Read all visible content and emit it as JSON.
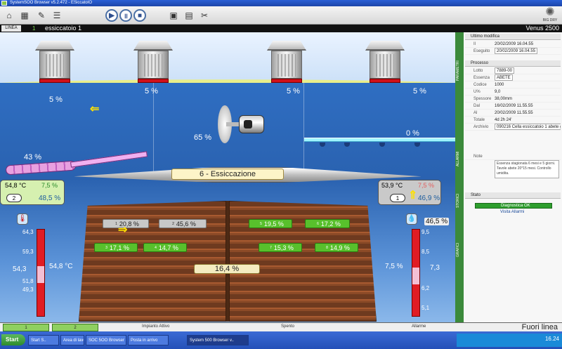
{
  "window": {
    "title": "SystemSOO Browser v5.2.472 - ESiccatoIO"
  },
  "toolbar": {
    "buttons": [
      {
        "name": "home-icon",
        "glyph": "⌂"
      },
      {
        "name": "chart-icon",
        "glyph": "▦"
      },
      {
        "name": "report-icon",
        "glyph": "✎"
      },
      {
        "name": "list-icon",
        "glyph": "☰"
      },
      {
        "name": "play-icon",
        "glyph": "▶"
      },
      {
        "name": "pause-icon",
        "glyph": "॥"
      },
      {
        "name": "stop-icon",
        "glyph": "■"
      },
      {
        "name": "screen-icon",
        "glyph": "▣"
      },
      {
        "name": "doc-icon",
        "glyph": "▤"
      },
      {
        "name": "tools-icon",
        "glyph": "✂"
      }
    ],
    "logo_text": "BIG DRY"
  },
  "header": {
    "tab_label": "LINEA",
    "number": "1",
    "kiln_name": "essiccatoio 1",
    "model": "Venus 2500"
  },
  "scene": {
    "vents_pct": [
      "5 %",
      "5 %",
      "5 %"
    ],
    "left_inlet_pct": "5 %",
    "fan_pct": "65 %",
    "humidifier_pct": "0 %",
    "heater_pct": "43 %",
    "phase": "6 - Essiccazione",
    "panel_left": {
      "temp": "54,8 °C",
      "humidity": "7,5 %",
      "index": "2",
      "rh": "48,5 %"
    },
    "panel_right": {
      "temp": "53,9 °C",
      "humidity": "7,5 %",
      "index": "1",
      "rh": "46,9 %"
    },
    "moisture_probes_top": [
      {
        "n": "1",
        "value": "20,8 %",
        "state": "gray"
      },
      {
        "n": "2",
        "value": "45,6 %",
        "state": "gray"
      },
      {
        "n": "5",
        "value": "19,5 %",
        "state": "green"
      },
      {
        "n": "6",
        "value": "17,2 %",
        "state": "green"
      }
    ],
    "moisture_probes_bottom": [
      {
        "n": "3",
        "value": "17,1 %",
        "state": "green"
      },
      {
        "n": "4",
        "value": "14,7 %",
        "state": "green"
      },
      {
        "n": "7",
        "value": "15,3 %",
        "state": "green"
      },
      {
        "n": "8",
        "value": "14,9 %",
        "state": "green"
      }
    ],
    "average_moisture": "16,4 %",
    "gauge_left": {
      "ticks": [
        "64,3",
        "59,3",
        "51,8",
        "49,3"
      ],
      "value": "54,3",
      "setpoint": "54,8 °C"
    },
    "gauge_right": {
      "ticks": [
        "9,5",
        "8,5",
        "6,2",
        "5,1"
      ],
      "value": "7,3",
      "setpoint": "7,5 %",
      "top_value": "46,5 %"
    }
  },
  "bottombar": {
    "tabs": [
      "1",
      "2"
    ],
    "status_a": "Impianto Attivo",
    "status_b": "Spento",
    "status_c": "Allarme",
    "mode": "Fuori linea"
  },
  "sidepanel": {
    "vertical_tabs": [
      "PARAMETRI",
      "ALLARMI",
      "STORICI",
      "GRAFICI"
    ],
    "sec1_title": "Ultimo modifica",
    "sec1_rows": [
      {
        "k": "Il",
        "v": "20/02/2009 16.04.55"
      },
      {
        "k": "Eseguito",
        "v": "20/02/2009 16.04.55"
      }
    ],
    "sec2_title": "Processo",
    "sec2_rows": [
      {
        "k": "Lotto",
        "v": "7889-00"
      },
      {
        "k": "Essenza",
        "v": "ABETE"
      },
      {
        "k": "Codice",
        "v": "1000"
      },
      {
        "k": "U%",
        "v": "9,0"
      },
      {
        "k": "Spessore",
        "v": "38,00mm"
      },
      {
        "k": "Dal",
        "v": "16/02/2009 11.55.55"
      },
      {
        "k": "Al",
        "v": "20/02/2009 11.55.55"
      },
      {
        "k": "Totale",
        "v": "4d 2h 24'"
      },
      {
        "k": "Archivio",
        "v": "090216 Cella essiccatoio 1 abete g"
      }
    ],
    "note_label": "Note",
    "note_text": "Essenza stagionata 6 mesi e 5 giorni. Tavole abete 20*15 mesi. Controllo umidita.",
    "sec3_title": "Stato",
    "diag_label": "Diagnostica OK",
    "diag_link": "Visita Allarmi"
  },
  "taskbar": {
    "start": "Start",
    "tasks": [
      {
        "label": "Start S..",
        "active": false
      },
      {
        "label": "Area di lavoro",
        "active": false
      },
      {
        "label": "SOC 5OO Browser - Fo..",
        "active": false
      },
      {
        "label": "Posta in arrivo",
        "active": false
      },
      {
        "label": "System 500 Browser v..",
        "active": true
      }
    ],
    "clock": "16.24"
  }
}
